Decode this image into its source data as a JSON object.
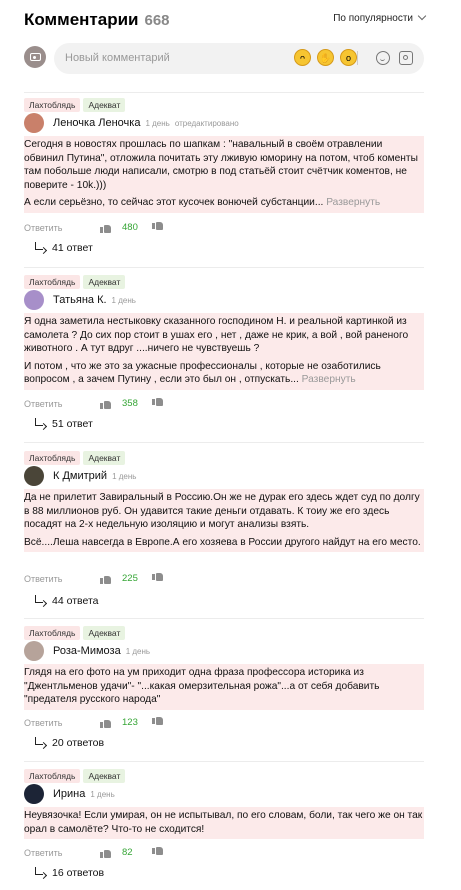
{
  "header": {
    "title": "Комментарии",
    "count": "668",
    "sort_label": "По популярности"
  },
  "composer": {
    "placeholder": "Новый комментарий",
    "emoji": [
      "laugh-emoji-icon",
      "clap-emoji-icon",
      "wow-emoji-icon"
    ]
  },
  "comments": [
    {
      "badges": [
        "Лахтоблядь",
        "Адекват"
      ],
      "author": "Леночка Леночка",
      "time": "1 день",
      "edited": "отредактировано",
      "avatar_color": "#c9806a",
      "paragraphs": [
        "Сегодня в новостях прошлась по шапкам : \"навальный в своём отравлении обвинил Путина\", отложила почитать эту лживую юморину на потом, чтоб коменты там побольше люди написали, смотрю в под статьёй стоит счётчик коментов, не поверите - 10k.)))",
        "А если серьёзно, то сейчас этот кусочек вонючей субстанции..."
      ],
      "expand": "Развернуть",
      "reply_label": "Ответить",
      "score": "480",
      "replies": "41 ответ"
    },
    {
      "badges": [
        "Лахтоблядь",
        "Адекват"
      ],
      "author": "Татьяна К.",
      "time": "1 день",
      "edited": "",
      "avatar_color": "#a78fc9",
      "paragraphs": [
        "Я одна заметила нестыковку сказанного господином Н. и реальной картинкой из самолета ? До сих пор стоит в ушах его , нет , даже не крик, а вой , вой раненого животного . А тут вдруг ....ничего не чувствуешь ?",
        "И потом , что же это за ужасные профессионалы , которые не озаботились вопросом , а зачем Путину , если это был он , отпускать..."
      ],
      "expand": "Развернуть",
      "reply_label": "Ответить",
      "score": "358",
      "replies": "51 ответ"
    },
    {
      "badges": [
        "Лахтоблядь",
        "Адекват"
      ],
      "author": "К Дмитрий",
      "time": "1 день",
      "edited": "",
      "avatar_color": "#4a4538",
      "paragraphs": [
        "Да не прилетит Завиральный в Россию.Он же не дурак его здесь ждет суд по долгу в 88 миллионов руб. Он удавится такие деньги отдавать. К тоиу же его здесь посадят на 2-х недельную изоляцию и могут анализы взять.",
        "Всё....Леша навсегда в Европе.А его хозяева в России другого найдут на его место."
      ],
      "expand": "",
      "reply_label": "Ответить",
      "score": "225",
      "replies": "44 ответа"
    },
    {
      "badges": [
        "Лахтоблядь",
        "Адекват"
      ],
      "author": "Роза-Мимоза",
      "time": "1 день",
      "edited": "",
      "avatar_color": "#b6a39a",
      "paragraphs": [
        "Глядя на его фото на ум приходит одна фраза профессора историка из \"Джентльменов удачи\"- \"...какая омерзительная рожа\"...а от себя добавить \"предателя русского народа\""
      ],
      "expand": "",
      "reply_label": "Ответить",
      "score": "123",
      "replies": "20 ответов"
    },
    {
      "badges": [
        "Лахтоблядь",
        "Адекват"
      ],
      "author": "Ирина",
      "time": "1 день",
      "edited": "",
      "avatar_color": "#1c2436",
      "paragraphs": [
        "Неувязочка! Если умирая, он не испытывал, по его словам, боли, так чего же он так орал в самолёте? Что-то не сходится!"
      ],
      "expand": "",
      "reply_label": "Ответить",
      "score": "82",
      "replies": "16 ответов"
    }
  ]
}
